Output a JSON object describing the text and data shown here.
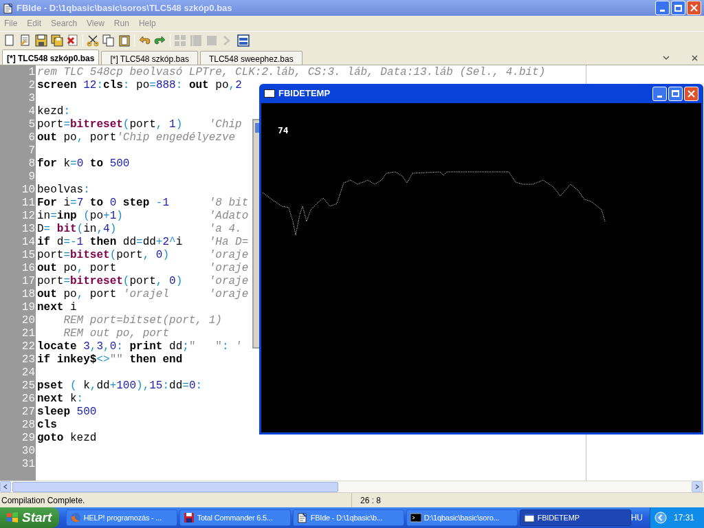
{
  "window": {
    "title": "FBIde - D:\\1qbasic\\basic\\soros\\TLC548 szkóp0.bas"
  },
  "menu": [
    "File",
    "Edit",
    "Search",
    "View",
    "Run",
    "Help"
  ],
  "toolbar": [
    [
      {
        "kind": "new",
        "disabled": false
      },
      {
        "kind": "open",
        "disabled": false
      },
      {
        "kind": "save",
        "disabled": false
      },
      {
        "kind": "saveall",
        "disabled": false
      },
      {
        "kind": "close",
        "disabled": false
      }
    ],
    [
      {
        "kind": "cut",
        "disabled": false
      },
      {
        "kind": "copy",
        "disabled": false
      },
      {
        "kind": "paste",
        "disabled": false
      }
    ],
    [
      {
        "kind": "undo",
        "disabled": false
      },
      {
        "kind": "redo",
        "disabled": false
      }
    ],
    [
      {
        "kind": "grid",
        "disabled": true
      },
      {
        "kind": "pane",
        "disabled": true
      },
      {
        "kind": "square",
        "disabled": true
      },
      {
        "kind": "arrow",
        "disabled": true
      },
      {
        "kind": "window",
        "disabled": false
      }
    ]
  ],
  "tabs": [
    {
      "label": "[*] TLC548 szkóp0.bas",
      "selected": true
    },
    {
      "label": "[*] TLC548 szkóp.bas",
      "selected": false
    },
    {
      "label": "TLC548 sweephez.bas",
      "selected": false
    }
  ],
  "editor": {
    "lines": [
      {
        "number": "1",
        "segments": [
          {
            "kind": "cm",
            "text": "rem TLC 548cp beolvasó LPTre, CLK:2.láb, CS:3. láb, Data:13.láb (Sel., 4.bit)"
          }
        ]
      },
      {
        "number": "2",
        "segments": [
          {
            "kind": "kw",
            "text": "screen"
          },
          {
            "kind": "num",
            "text": " 12"
          },
          {
            "kind": "op",
            "text": ":"
          },
          {
            "kind": "kw",
            "text": "cls"
          },
          {
            "kind": "op",
            "text": ":"
          },
          {
            "kind": "tx",
            "text": " po"
          },
          {
            "kind": "op",
            "text": "="
          },
          {
            "kind": "num",
            "text": "888"
          },
          {
            "kind": "op",
            "text": ":"
          },
          {
            "kind": "kw",
            "text": " out"
          },
          {
            "kind": "tx",
            "text": " po"
          },
          {
            "kind": "op",
            "text": ","
          },
          {
            "kind": "num",
            "text": "2"
          }
        ]
      },
      {
        "number": "3"
      },
      {
        "number": "4",
        "segments": [
          {
            "kind": "tx",
            "text": "kezd"
          },
          {
            "kind": "op",
            "text": ":"
          }
        ]
      },
      {
        "number": "5",
        "segments": [
          {
            "kind": "tx",
            "text": "port"
          },
          {
            "kind": "op",
            "text": "="
          },
          {
            "kind": "fn",
            "text": "bitreset"
          },
          {
            "kind": "op",
            "text": "("
          },
          {
            "kind": "tx",
            "text": "port"
          },
          {
            "kind": "op",
            "text": ","
          },
          {
            "kind": "num",
            "text": " 1"
          },
          {
            "kind": "op",
            "text": ")"
          },
          {
            "kind": "cm",
            "text": "    'Chip"
          }
        ]
      },
      {
        "number": "6",
        "segments": [
          {
            "kind": "kw",
            "text": "out"
          },
          {
            "kind": "tx",
            "text": " po"
          },
          {
            "kind": "op",
            "text": ","
          },
          {
            "kind": "tx",
            "text": " port"
          },
          {
            "kind": "cm",
            "text": "'Chip engedélyezve"
          }
        ]
      },
      {
        "number": "7"
      },
      {
        "number": "8",
        "segments": [
          {
            "kind": "kw",
            "text": "for"
          },
          {
            "kind": "tx",
            "text": " k"
          },
          {
            "kind": "op",
            "text": "="
          },
          {
            "kind": "num",
            "text": "0"
          },
          {
            "kind": "kw",
            "text": " to"
          },
          {
            "kind": "num",
            "text": " 500"
          }
        ]
      },
      {
        "number": "9"
      },
      {
        "number": "10",
        "segments": [
          {
            "kind": "tx",
            "text": "beolvas"
          },
          {
            "kind": "op",
            "text": ":"
          }
        ]
      },
      {
        "number": "11",
        "segments": [
          {
            "kind": "kw",
            "text": "For"
          },
          {
            "kind": "tx",
            "text": " i"
          },
          {
            "kind": "op",
            "text": "="
          },
          {
            "kind": "num",
            "text": "7"
          },
          {
            "kind": "kw",
            "text": " to"
          },
          {
            "kind": "num",
            "text": " 0"
          },
          {
            "kind": "kw",
            "text": " step"
          },
          {
            "kind": "op",
            "text": " -"
          },
          {
            "kind": "num",
            "text": "1"
          },
          {
            "kind": "cm",
            "text": "      '8 bit"
          }
        ]
      },
      {
        "number": "12",
        "segments": [
          {
            "kind": "tx",
            "text": "in"
          },
          {
            "kind": "op",
            "text": "="
          },
          {
            "kind": "kw",
            "text": "inp"
          },
          {
            "kind": "op",
            "text": " ("
          },
          {
            "kind": "tx",
            "text": "po"
          },
          {
            "kind": "op",
            "text": "+"
          },
          {
            "kind": "num",
            "text": "1"
          },
          {
            "kind": "op",
            "text": ")"
          },
          {
            "kind": "cm",
            "text": "             'Adato"
          }
        ]
      },
      {
        "number": "13",
        "segments": [
          {
            "kind": "tx",
            "text": "D"
          },
          {
            "kind": "op",
            "text": "="
          },
          {
            "kind": "fn",
            "text": " bit"
          },
          {
            "kind": "op",
            "text": "("
          },
          {
            "kind": "tx",
            "text": "in"
          },
          {
            "kind": "op",
            "text": ","
          },
          {
            "kind": "num",
            "text": "4"
          },
          {
            "kind": "op",
            "text": ")"
          },
          {
            "kind": "cm",
            "text": "              'a 4."
          }
        ]
      },
      {
        "number": "14",
        "segments": [
          {
            "kind": "kw",
            "text": "if"
          },
          {
            "kind": "tx",
            "text": " d"
          },
          {
            "kind": "op",
            "text": "=-"
          },
          {
            "kind": "num",
            "text": "1"
          },
          {
            "kind": "kw",
            "text": " then"
          },
          {
            "kind": "tx",
            "text": " dd"
          },
          {
            "kind": "op",
            "text": "="
          },
          {
            "kind": "tx",
            "text": "dd"
          },
          {
            "kind": "op",
            "text": "+"
          },
          {
            "kind": "num",
            "text": "2"
          },
          {
            "kind": "op",
            "text": "^"
          },
          {
            "kind": "tx",
            "text": "i"
          },
          {
            "kind": "cm",
            "text": "    'Ha D="
          }
        ]
      },
      {
        "number": "15",
        "segments": [
          {
            "kind": "tx",
            "text": "port"
          },
          {
            "kind": "op",
            "text": "="
          },
          {
            "kind": "fn",
            "text": "bitset"
          },
          {
            "kind": "op",
            "text": "("
          },
          {
            "kind": "tx",
            "text": "port"
          },
          {
            "kind": "op",
            "text": ","
          },
          {
            "kind": "num",
            "text": " 0"
          },
          {
            "kind": "op",
            "text": ")"
          },
          {
            "kind": "cm",
            "text": "      'oraje"
          }
        ]
      },
      {
        "number": "16",
        "segments": [
          {
            "kind": "kw",
            "text": "out"
          },
          {
            "kind": "tx",
            "text": " po"
          },
          {
            "kind": "op",
            "text": ","
          },
          {
            "kind": "tx",
            "text": " port"
          },
          {
            "kind": "cm",
            "text": "              'oraje"
          }
        ]
      },
      {
        "number": "17",
        "segments": [
          {
            "kind": "tx",
            "text": "port"
          },
          {
            "kind": "op",
            "text": "="
          },
          {
            "kind": "fn",
            "text": "bitreset"
          },
          {
            "kind": "op",
            "text": "("
          },
          {
            "kind": "tx",
            "text": "port"
          },
          {
            "kind": "op",
            "text": ","
          },
          {
            "kind": "num",
            "text": " 0"
          },
          {
            "kind": "op",
            "text": ")"
          },
          {
            "kind": "cm",
            "text": "    'oraje"
          }
        ]
      },
      {
        "number": "18",
        "segments": [
          {
            "kind": "kw",
            "text": "out"
          },
          {
            "kind": "tx",
            "text": " po"
          },
          {
            "kind": "op",
            "text": ","
          },
          {
            "kind": "tx",
            "text": " port"
          },
          {
            "kind": "cm",
            "text": " 'orajel      'oraje"
          }
        ]
      },
      {
        "number": "19",
        "segments": [
          {
            "kind": "kw",
            "text": "next"
          },
          {
            "kind": "tx",
            "text": " i"
          }
        ]
      },
      {
        "number": "20",
        "segments": [
          {
            "kind": "cm",
            "text": "    REM port=bitset(port, 1)"
          }
        ]
      },
      {
        "number": "21",
        "segments": [
          {
            "kind": "cm",
            "text": "    REM out po, port"
          }
        ]
      },
      {
        "number": "22",
        "segments": [
          {
            "kind": "kw",
            "text": "locate"
          },
          {
            "kind": "num",
            "text": " 3"
          },
          {
            "kind": "op",
            "text": ","
          },
          {
            "kind": "num",
            "text": "3"
          },
          {
            "kind": "op",
            "text": ","
          },
          {
            "kind": "num",
            "text": "0"
          },
          {
            "kind": "op",
            "text": ":"
          },
          {
            "kind": "kw",
            "text": " print"
          },
          {
            "kind": "tx",
            "text": " dd"
          },
          {
            "kind": "op",
            "text": ";"
          },
          {
            "kind": "str",
            "text": "\"   \""
          },
          {
            "kind": "op",
            "text": ":"
          },
          {
            "kind": "cm",
            "text": " '"
          }
        ]
      },
      {
        "number": "23",
        "segments": [
          {
            "kind": "kw",
            "text": "if"
          },
          {
            "kind": "kw",
            "text": " inkey$"
          },
          {
            "kind": "op",
            "text": "<>"
          },
          {
            "kind": "str",
            "text": "\"\""
          },
          {
            "kind": "kw",
            "text": " then"
          },
          {
            "kind": "kw",
            "text": " end"
          }
        ]
      },
      {
        "number": "24"
      },
      {
        "number": "25",
        "segments": [
          {
            "kind": "kw",
            "text": "pset"
          },
          {
            "kind": "op",
            "text": " ("
          },
          {
            "kind": "tx",
            "text": " k"
          },
          {
            "kind": "op",
            "text": ","
          },
          {
            "kind": "tx",
            "text": "dd"
          },
          {
            "kind": "op",
            "text": "+"
          },
          {
            "kind": "num",
            "text": "100"
          },
          {
            "kind": "op",
            "text": "),"
          },
          {
            "kind": "num",
            "text": "15"
          },
          {
            "kind": "op",
            "text": ":"
          },
          {
            "kind": "tx",
            "text": "dd"
          },
          {
            "kind": "op",
            "text": "="
          },
          {
            "kind": "num",
            "text": "0"
          },
          {
            "kind": "op",
            "text": ":"
          }
        ]
      },
      {
        "number": "26",
        "segments": [
          {
            "kind": "kw",
            "text": "next"
          },
          {
            "kind": "tx",
            "text": " k"
          },
          {
            "kind": "op",
            "text": ":"
          }
        ]
      },
      {
        "number": "27",
        "segments": [
          {
            "kind": "kw",
            "text": "sleep"
          },
          {
            "kind": "num",
            "text": " 500"
          }
        ]
      },
      {
        "number": "28",
        "segments": [
          {
            "kind": "kw",
            "text": "cls"
          }
        ]
      },
      {
        "number": "29",
        "segments": [
          {
            "kind": "kw",
            "text": "goto"
          },
          {
            "kind": "tx",
            "text": " kezd"
          }
        ]
      },
      {
        "number": "30"
      },
      {
        "number": "31"
      }
    ]
  },
  "status_bar": {
    "message": "Compilation Complete.",
    "position": "26 : 8"
  },
  "output_window": {
    "title": "FBIDETEMP",
    "active": true,
    "text": "74"
  },
  "taskbar": {
    "start": "Start",
    "buttons": [
      {
        "kind": "firefox",
        "label": "HELP! programozás - ...",
        "selected": false
      },
      {
        "kind": "floppy",
        "label": "Total Commander 6.5...",
        "selected": false
      },
      {
        "kind": "fbide",
        "label": "FBIde - D:\\1qbasic\\b...",
        "selected": false
      },
      {
        "kind": "console",
        "label": "D:\\1qbasic\\basic\\soro...",
        "selected": false
      },
      {
        "kind": "window",
        "label": "FBIDETEMP",
        "selected": true
      }
    ],
    "language": "HU",
    "clock": "17:31"
  }
}
